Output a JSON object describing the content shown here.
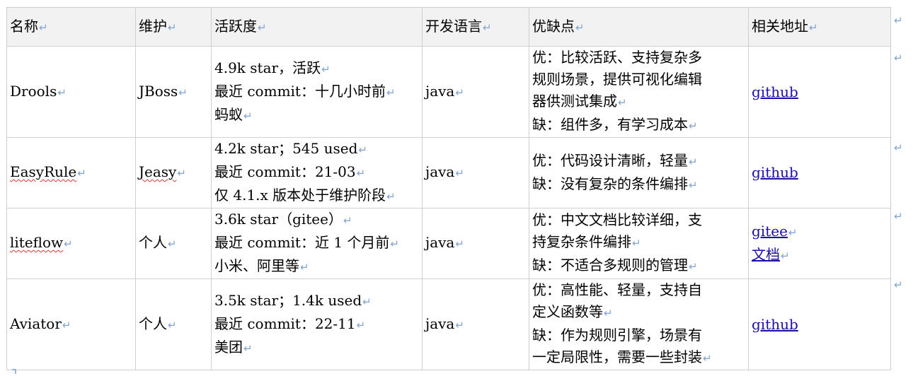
{
  "paragraph_mark": "↵",
  "headers": [
    "名称",
    "维护",
    "活跃度",
    "开发语言",
    "优缺点",
    "相关地址"
  ],
  "rows": [
    {
      "name": "Drools",
      "maintainer": "JBoss",
      "activity": [
        "4.9k star，活跃",
        "最近 commit：十几小时前",
        "蚂蚁"
      ],
      "language": "java",
      "pros_cons": [
        "优：比较活跃、支持复杂多",
        "规则场景，提供可视化编辑",
        "器供测试集成",
        "缺：组件多，有学习成本"
      ],
      "links": [
        "github"
      ]
    },
    {
      "name": "EasyRule",
      "maintainer": "Jeasy",
      "activity": [
        "4.2k star；545 used",
        "最近 commit：21-03",
        "仅 4.1.x 版本处于维护阶段"
      ],
      "language": "java",
      "pros_cons": [
        "优：代码设计清晰，轻量",
        "缺：没有复杂的条件编排"
      ],
      "links": [
        "github"
      ]
    },
    {
      "name": "liteflow",
      "maintainer": "个人",
      "activity": [
        "3.6k star（gitee）",
        "最近 commit：近 1 个月前",
        "小米、阿里等"
      ],
      "language": "java",
      "pros_cons": [
        "优：中文文档比较详细，支",
        "持复杂条件编排",
        "缺：不适合多规则的管理"
      ],
      "links": [
        "gitee",
        "文档"
      ]
    },
    {
      "name": "Aviator",
      "maintainer": "个人",
      "activity": [
        "3.5k star；1.4k used",
        "最近 commit：22-11",
        "美团"
      ],
      "language": "java",
      "pros_cons": [
        "优：高性能、轻量，支持自",
        "定义函数等",
        "缺：作为规则引擎，场景有",
        "一定局限性，需要一些封装"
      ],
      "links": [
        "github"
      ]
    }
  ],
  "colors": {
    "link": "#1a0dab",
    "mark": "#7fa4cf",
    "border": "#cfcfcf",
    "header_bg": "#f2f2f2",
    "spellcheck": "#d33"
  }
}
